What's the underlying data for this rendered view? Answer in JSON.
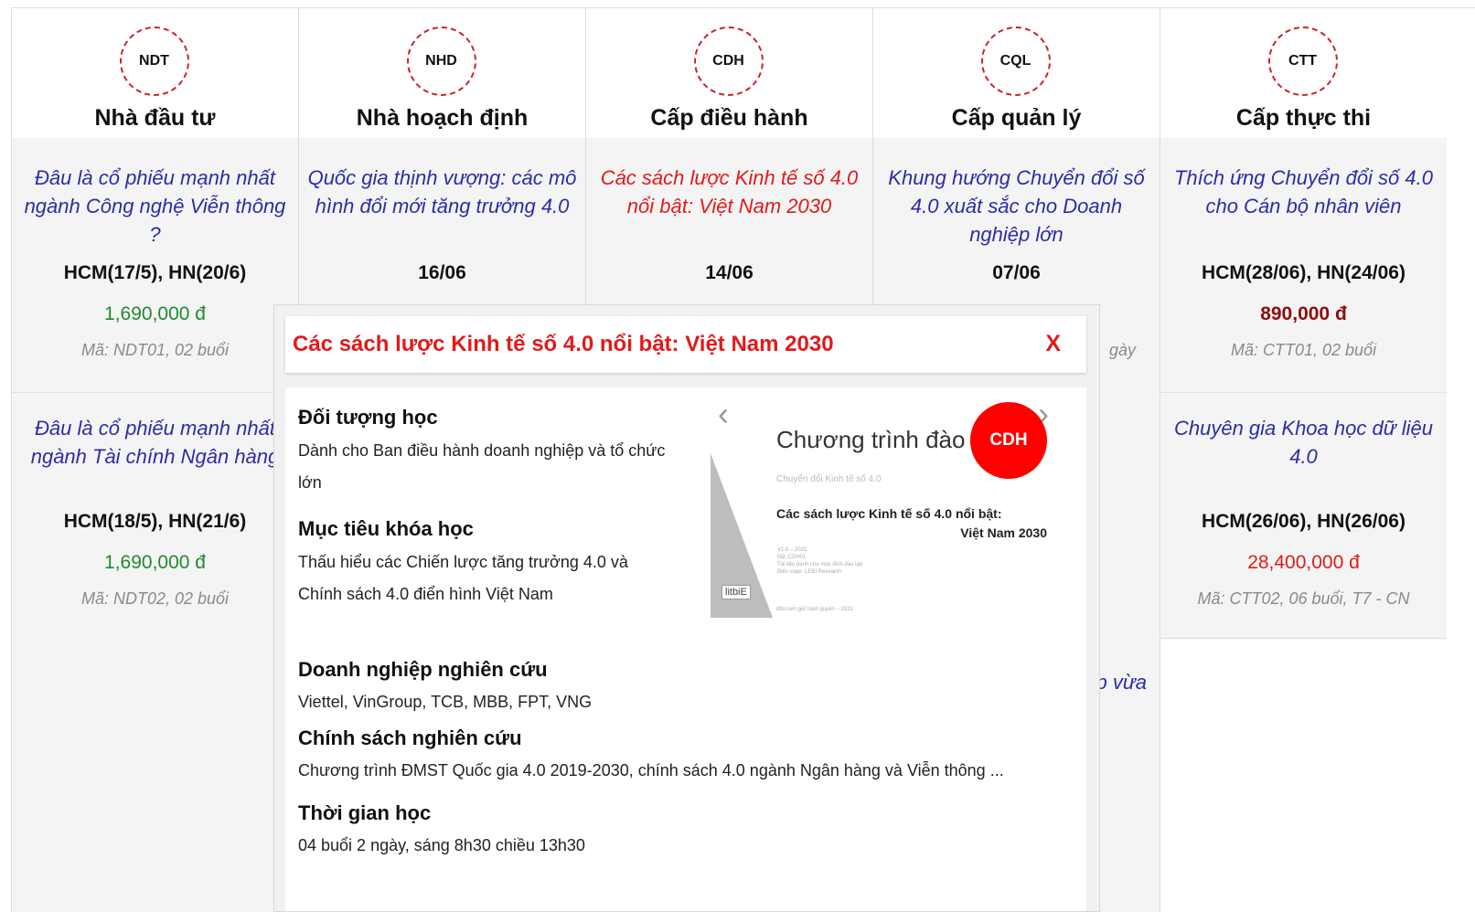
{
  "columns": [
    {
      "code": "NDT",
      "title": "Nhà đầu tư",
      "cards": [
        {
          "title": "Đâu là cổ phiếu mạnh nhất ngành Công nghệ Viễn thông ?",
          "date": "HCM(17/5), HN(20/6)",
          "price": "1,690,000 đ",
          "code_line": "Mã: NDT01, 02 buổi"
        },
        {
          "title": "Đâu là cổ phiếu mạnh nhất ngành Tài chính Ngân hàng",
          "date": "HCM(18/5), HN(21/6)",
          "price": "1,690,000 đ",
          "code_line": "Mã: NDT02, 02 buổi"
        }
      ]
    },
    {
      "code": "NHD",
      "title": "Nhà hoạch định",
      "cards": [
        {
          "title": "Quốc gia thịnh vượng: các mô hình đổi mới tăng trưởng 4.0",
          "date": "16/06"
        }
      ]
    },
    {
      "code": "CDH",
      "title": "Cấp điều hành",
      "cards": [
        {
          "title": "Các sách lược Kinh tế số 4.0 nổi bật: Việt Nam 2030",
          "date": "14/06"
        }
      ]
    },
    {
      "code": "CQL",
      "title": "Cấp quản lý",
      "cards": [
        {
          "title": "Khung hướng Chuyển đổi số 4.0 xuất sắc cho Doanh nghiệp lớn",
          "date": "07/06",
          "partial_code": "gày",
          "partial_title": "p vừa"
        }
      ]
    },
    {
      "code": "CTT",
      "title": "Cấp thực thi",
      "cards": [
        {
          "title": "Thích ứng Chuyển đổi số 4.0 cho Cán bộ nhân viên",
          "date": "HCM(28/06), HN(24/06)",
          "price": "890,000 đ",
          "code_line": "Mã: CTT01, 02 buổi"
        },
        {
          "title": "Chuyên gia Khoa học dữ liệu 4.0",
          "date": "HCM(26/06), HN(26/06)",
          "price": "28,400,000 đ",
          "code_line": "Mã: CTT02, 06 buổi, T7 - CN"
        }
      ]
    }
  ],
  "modal": {
    "title": "Các sách lược Kinh tế số 4.0 nổi bật: Việt Nam 2030",
    "close_label": "X",
    "sections": {
      "audience_h": "Đối tượng học",
      "audience_t": "Dành cho Ban điều hành doanh nghiệp và tổ chức lớn",
      "goal_h": "Mục tiêu khóa học",
      "goal_t": "Thấu hiểu các Chiến lược tăng trưởng 4.0 và Chính sách 4.0 điển hình Việt Nam",
      "biz_h": "Doanh nghiệp nghiên cứu",
      "biz_t": "Viettel, VinGroup, TCB, MBB, FPT, VNG",
      "policy_h": "Chính sách nghiên cứu",
      "policy_t": "Chương trình ĐMST Quốc gia 4.0 2019-2030, chính sách 4.0 ngành Ngân hàng và Viễn thông ...",
      "time_h": "Thời gian học",
      "time_t": "04 buổi 2 ngày, sáng 8h30 chiều 13h30"
    },
    "slide": {
      "heading": "Chương trình đào tạo",
      "sub": "Chuyển đổi Kinh tế số 4.0",
      "course_l1": "Các sách lược Kinh tế số 4.0 nổi bật:",
      "course_l2": "Việt Nam 2030",
      "badge": "CDH",
      "brand": "litbiE",
      "meta": [
        "V1.0 – 2021",
        "Mã: CDH01",
        "Tài liệu dành cho mục đích đào tạo",
        "Biên soạn: LEBI Research"
      ],
      "footer": "litbi.com giữ toàn quyền – 2021",
      "prev_icon": "‹",
      "next_icon": "›"
    }
  }
}
